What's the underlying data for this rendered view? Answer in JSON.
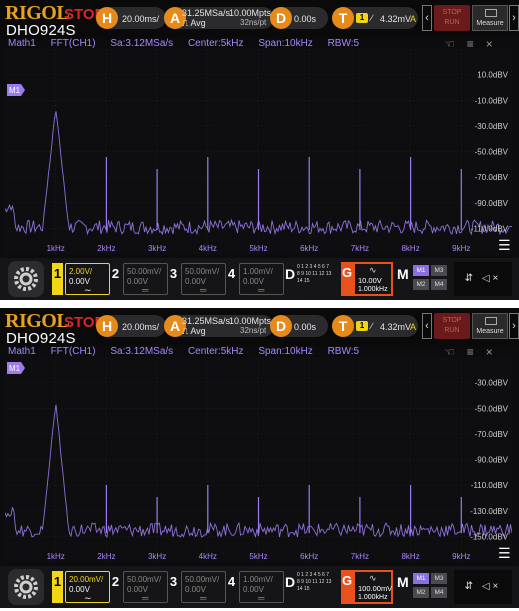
{
  "screens": [
    {
      "brand": "RIGOL",
      "run_state": "STOP",
      "model": "DHO924S",
      "horizontal": {
        "letter": "H",
        "timebase": "20.00ms/"
      },
      "acquire": {
        "letter": "A",
        "sample_rate": "31.25MSa/s",
        "mode": "Avg",
        "memory_depth": "10.00Mpts",
        "pts": "32ns/pt"
      },
      "delay": {
        "letter": "D",
        "value": "0.00s"
      },
      "trigger": {
        "letter": "T",
        "source": "1",
        "edge": "∕",
        "level": "4.32mV",
        "mode": "A"
      },
      "nav_left": "‹",
      "nav_right": "›",
      "stop_run": {
        "line1": "STOP",
        "line2": "RUN"
      },
      "measure_label": "Measure",
      "info": {
        "math": "Math1",
        "source": "FFT(CH1)",
        "sa": "Sa:3.12MSa/s",
        "center": "Center:5kHz",
        "span": "Span:10kHz",
        "rbw": "RBW:5"
      },
      "marker": "M1",
      "y_labels": [
        "10.0dBV",
        "-10.0dBV",
        "-30.0dBV",
        "-50.0dBV",
        "-70.0dBV",
        "-90.0dBV",
        "-110.0dBV"
      ],
      "x_labels": [
        "1kHz",
        "2kHz",
        "3kHz",
        "4kHz",
        "5kHz",
        "6kHz",
        "7kHz",
        "8kHz",
        "9kHz"
      ],
      "channels": [
        {
          "num": "1",
          "scale": "2.00V/",
          "offset": "0.00V",
          "coupling": "∼",
          "active": true
        },
        {
          "num": "2",
          "scale": "50.00mV/",
          "offset": "0.00V",
          "coupling": "═",
          "active": false
        },
        {
          "num": "3",
          "scale": "50.00mV/",
          "offset": "0.00V",
          "coupling": "═",
          "active": false
        },
        {
          "num": "4",
          "scale": "1.00mV/",
          "offset": "0.00V",
          "coupling": "═",
          "active": false
        }
      ],
      "digital": {
        "label": "D",
        "grid": "0 1 2 3 4 5 6 7 8 9 10 11 12 13 14 15"
      },
      "generator": {
        "label": "G",
        "wave": "∿",
        "amplitude": "10.00V",
        "frequency": "1.000kHz"
      },
      "math_menu": {
        "label": "M",
        "buttons": [
          "M1",
          "M3",
          "M2",
          "M4"
        ]
      },
      "status_icons": "⇵ ◁×"
    },
    {
      "brand": "RIGOL",
      "run_state": "STOP",
      "model": "DHO924S",
      "horizontal": {
        "letter": "H",
        "timebase": "20.00ms/"
      },
      "acquire": {
        "letter": "A",
        "sample_rate": "31.25MSa/s",
        "mode": "Avg",
        "memory_depth": "10.00Mpts",
        "pts": "32ns/pt"
      },
      "delay": {
        "letter": "D",
        "value": "0.00s"
      },
      "trigger": {
        "letter": "T",
        "source": "1",
        "edge": "∕",
        "level": "4.32mV",
        "mode": "A"
      },
      "nav_left": "‹",
      "nav_right": "›",
      "stop_run": {
        "line1": "STOP",
        "line2": "RUN"
      },
      "measure_label": "Measure",
      "info": {
        "math": "Math1",
        "source": "FFT(CH1)",
        "sa": "Sa:3.12MSa/s",
        "center": "Center:5kHz",
        "span": "Span:10kHz",
        "rbw": "RBW:5"
      },
      "marker": "M1",
      "y_labels": [
        "-30.0dBV",
        "-50.0dBV",
        "-70.0dBV",
        "-90.0dBV",
        "-110.0dBV",
        "-130.0dBV",
        "-150.0dBV"
      ],
      "x_labels": [
        "1kHz",
        "2kHz",
        "3kHz",
        "4kHz",
        "5kHz",
        "6kHz",
        "7kHz",
        "8kHz",
        "9kHz"
      ],
      "channels": [
        {
          "num": "1",
          "scale": "20.00mV/",
          "offset": "0.00V",
          "coupling": "∼",
          "active": true
        },
        {
          "num": "2",
          "scale": "50.00mV/",
          "offset": "0.00V",
          "coupling": "═",
          "active": false
        },
        {
          "num": "3",
          "scale": "50.00mV/",
          "offset": "0.00V",
          "coupling": "═",
          "active": false
        },
        {
          "num": "4",
          "scale": "1.00mV/",
          "offset": "0.00V",
          "coupling": "═",
          "active": false
        }
      ],
      "digital": {
        "label": "D",
        "grid": "0 1 2 3 4 5 6 7 8 9 10 11 12 13 14 15"
      },
      "generator": {
        "label": "G",
        "wave": "∿",
        "amplitude": "100.00mV",
        "frequency": "1.000kHz"
      },
      "math_menu": {
        "label": "M",
        "buttons": [
          "M1",
          "M3",
          "M2",
          "M4"
        ]
      },
      "status_icons": "⇵ ◁×"
    }
  ],
  "colors": {
    "brand": "#e8a020",
    "stop": "#d8262a",
    "accent_orange": "#e68a1a",
    "channel1": "#f0d616",
    "math_trace": "#9b7cf0",
    "generator": "#e8501c"
  }
}
